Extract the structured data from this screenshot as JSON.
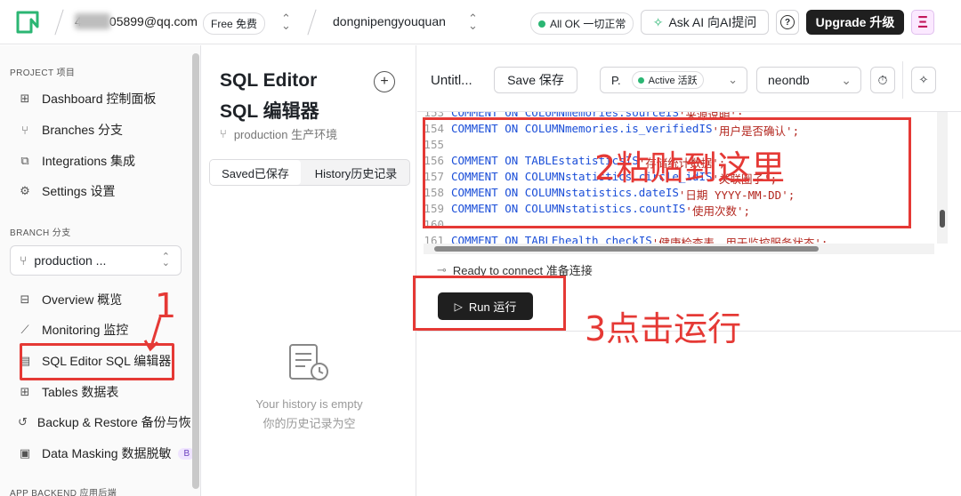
{
  "topbar": {
    "email": "4        05899@qq.com",
    "plan": "Free 免费",
    "project": "dongnipengyouquan",
    "status": "All OK 一切正常",
    "ask_ai": "Ask AI 向AI提问",
    "help": "?",
    "upgrade": "Upgrade 升级",
    "avatar_letter": "Ξ"
  },
  "sidebar": {
    "project_section": "PROJECT 项目",
    "project_items": [
      {
        "label": "Dashboard 控制面板",
        "icon": "dashboard-icon"
      },
      {
        "label": "Branches 分支",
        "icon": "branch-icon"
      },
      {
        "label": "Integrations 集成",
        "icon": "integrations-icon"
      },
      {
        "label": "Settings 设置",
        "icon": "gear-icon"
      }
    ],
    "branch_section": "BRANCH 分支",
    "branch_select": "production ...",
    "branch_items": [
      {
        "label": "Overview 概览",
        "icon": "overview-icon"
      },
      {
        "label": "Monitoring 监控",
        "icon": "chart-icon"
      },
      {
        "label": "SQL Editor SQL 编辑器",
        "icon": "sql-icon"
      },
      {
        "label": "Tables 数据表",
        "icon": "table-icon"
      },
      {
        "label": "Backup & Restore 备份与恢",
        "icon": "backup-icon"
      },
      {
        "label": "Data Masking 数据脱敏",
        "icon": "masking-icon",
        "badge": "B"
      }
    ],
    "backend_section": "APP BACKEND 应用后端"
  },
  "middle": {
    "title_en": "SQL Editor",
    "title_zh": "SQL 编辑器",
    "branch": "production 生产环境",
    "tab_saved": "Saved已保存",
    "tab_history": "History历史记录",
    "empty_en": "Your history is empty",
    "empty_zh": "你的历史记录为空"
  },
  "editor": {
    "tab_title": "Untitl...",
    "save": "Save 保存",
    "branch_short": "P.",
    "branch_status": "Active 活跃",
    "database": "neondb",
    "status_text": "Ready to connect 准备连接",
    "run": "Run 运行",
    "code_lines": [
      {
        "n": "153",
        "kw": "COMMENT ON COLUMN",
        "id": "memories.source",
        "is": "IS",
        "str": "'来源说明';"
      },
      {
        "n": "154",
        "kw": "COMMENT ON COLUMN",
        "id": "memories.is_verified",
        "is": "IS",
        "str": "'用户是否确认';"
      },
      {
        "n": "155",
        "kw": "",
        "id": "",
        "is": "",
        "str": ""
      },
      {
        "n": "156",
        "kw": "COMMENT ON TABLE",
        "id": "statistics",
        "is": "IS",
        "str": "'存储统计数据';"
      },
      {
        "n": "157",
        "kw": "COMMENT ON COLUMN",
        "id": "statistics.circle_id",
        "is": "IS",
        "str": "'关联圈子';"
      },
      {
        "n": "158",
        "kw": "COMMENT ON COLUMN",
        "id": "statistics.date",
        "is": "IS",
        "str": "'日期 YYYY-MM-DD';"
      },
      {
        "n": "159",
        "kw": "COMMENT ON COLUMN",
        "id": "statistics.count",
        "is": "IS",
        "str": "'使用次数';"
      },
      {
        "n": "160",
        "kw": "",
        "id": "",
        "is": "",
        "str": ""
      },
      {
        "n": "161",
        "kw": "COMMENT ON TABLE",
        "id": "health_check",
        "is": "IS",
        "str": "'健康检查表，用于监控服务状态';"
      }
    ]
  },
  "annotations": {
    "step1": "1",
    "step2": "2粘贴到这里",
    "step3": "3点击运行"
  },
  "colors": {
    "accent": "#2bb673",
    "annotation": "#e53935",
    "dark_button": "#1f1f1f"
  }
}
